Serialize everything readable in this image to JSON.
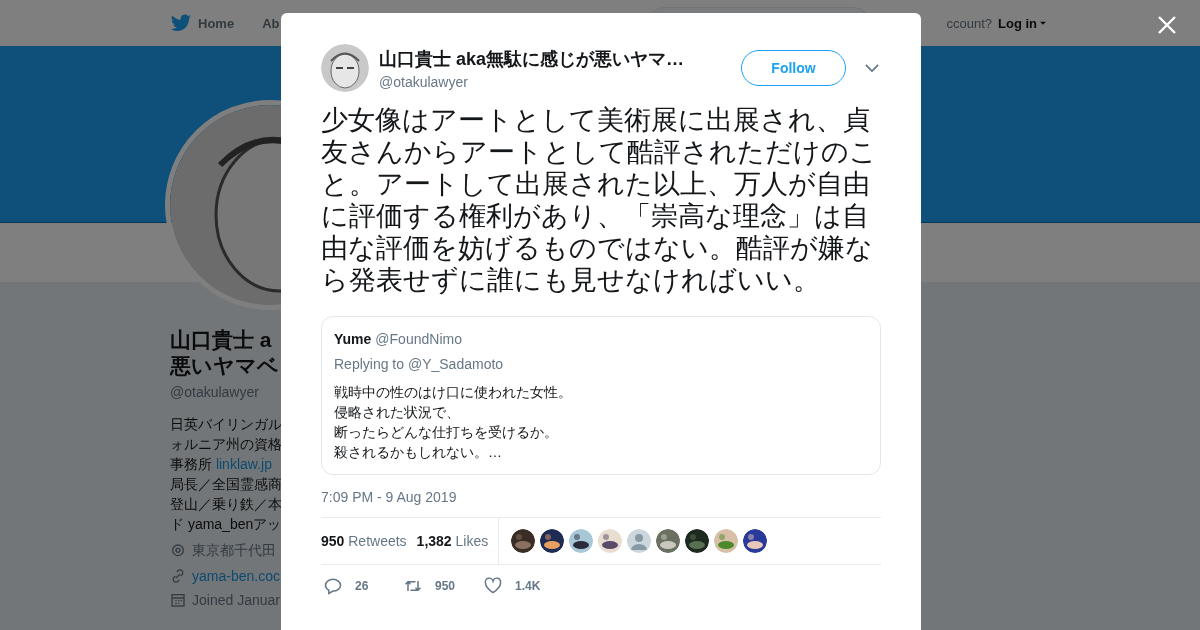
{
  "top_nav": {
    "items": [
      {
        "label": "Home",
        "kind": "home"
      },
      {
        "label": "Ab",
        "kind": "plain"
      }
    ],
    "login_prompt": "ccount?",
    "login_link": "Log in"
  },
  "profile": {
    "name_lines": [
      "山口貴士 a",
      "悪いヤマベ"
    ],
    "handle": "@otakulawyer",
    "bio_lines": [
      {
        "text": "日英バイリンガル"
      },
      {
        "text": "ォルニア州の資格"
      },
      {
        "text": "事務所 ",
        "link": "linklaw.jp"
      },
      {
        "text": "局長／全国霊感商"
      },
      {
        "text": "登山／乗り鉄／本"
      },
      {
        "text": "ド yama_benアッ"
      }
    ],
    "details": [
      {
        "kind": "location",
        "text": "東京都千代田"
      },
      {
        "kind": "link",
        "text": "yama-ben.coc"
      },
      {
        "kind": "joined",
        "text": "Joined Januar"
      }
    ]
  },
  "tweet": {
    "author_name": "山口貴士 aka無駄に感じが悪いヤマ…",
    "author_handle": "@otakulawyer",
    "follow_button": "Follow",
    "text": "少女像はアートとして美術展に出展され、貞友さんからアートとして酷評されただけのこと。アートして出展された以上、万人が自由に評価する権利があり、「崇高な理念」は自由な評価を妨げるものではない。酷評が嫌なら発表せずに誰にも見せなければいい。",
    "quoted": {
      "name": "Yume",
      "handle": "@FoundNimo",
      "replying_to": "Replying to @Y_Sadamoto",
      "lines": [
        "戦時中の性のはけ口に使われた女性。",
        "侵略された状況で、",
        "断ったらどんな仕打ちを受けるか。",
        "殺されるかもしれない。…"
      ]
    },
    "timestamp": "7:09 PM - 9 Aug 2019",
    "stats": [
      {
        "count": "950",
        "label": "Retweets"
      },
      {
        "count": "1,382",
        "label": "Likes"
      }
    ],
    "liker_avatars": [
      {
        "kind": "picture"
      },
      {
        "kind": "picture"
      },
      {
        "kind": "picture"
      },
      {
        "kind": "picture"
      },
      {
        "kind": "default"
      },
      {
        "kind": "picture"
      },
      {
        "kind": "picture"
      },
      {
        "kind": "picture"
      },
      {
        "kind": "picture"
      }
    ],
    "actions": [
      {
        "kind": "reply",
        "count": "26"
      },
      {
        "kind": "retweet",
        "count": "950"
      },
      {
        "kind": "like",
        "count": "1.4K"
      }
    ]
  }
}
